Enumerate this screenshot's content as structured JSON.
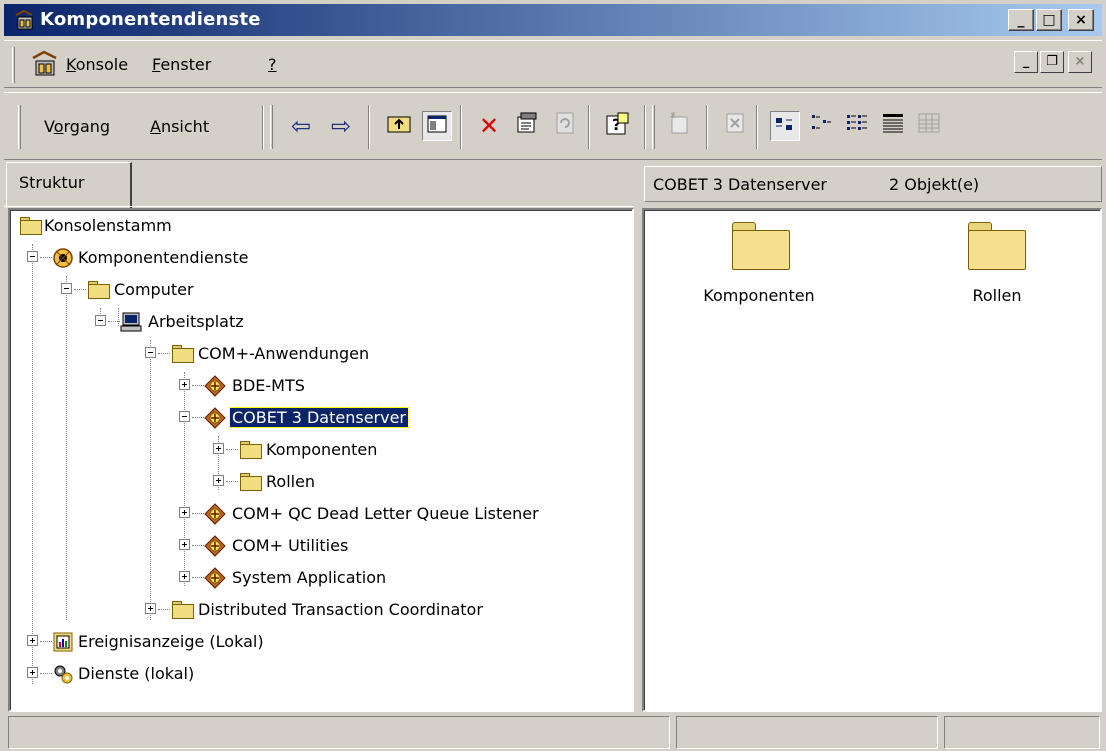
{
  "window": {
    "title": "Komponentendienste",
    "controls": [
      "_",
      "□",
      "×"
    ]
  },
  "menubar": {
    "items": [
      {
        "label": "Konsole",
        "accel_index": 0
      },
      {
        "label": "Fenster",
        "accel_index": 0
      },
      {
        "label": "?",
        "accel_index": 0
      }
    ],
    "mdi_controls": [
      "_",
      "❐",
      "×"
    ]
  },
  "toolbar": {
    "vorgang": "Vorgang",
    "ansicht": "Ansicht",
    "icons": [
      "back-arrow-icon",
      "forward-arrow-icon",
      "up-one-level-icon",
      "show-hide-tree-icon",
      "delete-icon",
      "properties-icon",
      "refresh-icon",
      "help-icon",
      "new-icon",
      "export-list-icon",
      "large-icons-view-icon",
      "small-icons-view-icon",
      "list-view-icon",
      "details-view-icon",
      "details-disabled-icon"
    ]
  },
  "tab": {
    "label": "Struktur"
  },
  "list_header": {
    "location": "COBET 3 Datenserver",
    "count": "2 Objekt(e)"
  },
  "tree": {
    "rows": [
      {
        "label": "Konsolenstamm",
        "icon": "folder-icon",
        "level": 0
      },
      {
        "label": "Komponentendienste",
        "icon": "component-services-icon",
        "level": 1
      },
      {
        "label": "Computer",
        "icon": "folder-icon",
        "level": 2
      },
      {
        "label": "Arbeitsplatz",
        "icon": "computer-icon",
        "level": 3
      },
      {
        "label": "COM+-Anwendungen",
        "icon": "folder-icon",
        "level": 4
      },
      {
        "label": "BDE-MTS",
        "icon": "com-app-icon",
        "level": 5
      },
      {
        "label": "COBET 3 Datenserver",
        "icon": "com-app-icon",
        "level": 5,
        "selected": true
      },
      {
        "label": "Komponenten",
        "icon": "folder-icon",
        "level": 6
      },
      {
        "label": "Rollen",
        "icon": "folder-icon",
        "level": 6
      },
      {
        "label": "COM+ QC Dead Letter Queue Listener",
        "icon": "com-app-icon",
        "level": 5
      },
      {
        "label": "COM+ Utilities",
        "icon": "com-app-icon",
        "level": 5
      },
      {
        "label": "System Application",
        "icon": "com-app-icon",
        "level": 5
      },
      {
        "label": "Distributed Transaction Coordinator",
        "icon": "folder-icon",
        "level": 4
      },
      {
        "label": "Ereignisanzeige (Lokal)",
        "icon": "event-viewer-icon",
        "level": 1
      },
      {
        "label": "Dienste (lokal)",
        "icon": "services-icon",
        "level": 1
      }
    ]
  },
  "list": {
    "items": [
      {
        "label": "Komponenten",
        "icon": "folder-icon"
      },
      {
        "label": "Rollen",
        "icon": "folder-icon"
      }
    ]
  },
  "colors": {
    "title_start": "#0a246a",
    "title_end": "#a6caf0",
    "face": "#d4d0c8",
    "selection": "#0a246a"
  }
}
